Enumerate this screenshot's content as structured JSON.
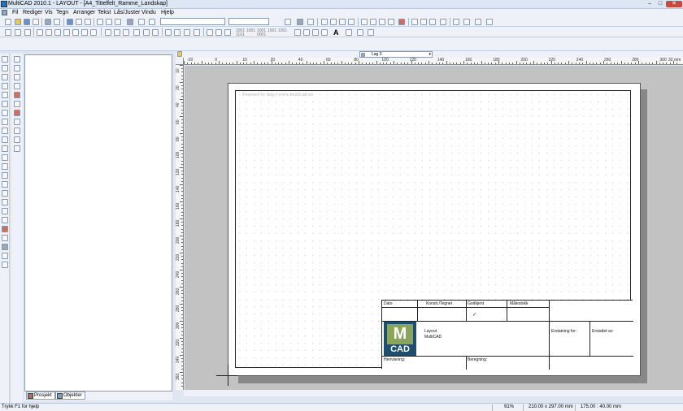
{
  "window": {
    "title": "MultiCAD 2010.1 - LAYOUT - [A4_Tittelfelt_Ramme_Landskap]",
    "minimize": "–",
    "maximize": "□",
    "close": "✕"
  },
  "menu": [
    "Fil",
    "Rediger",
    "Vis",
    "Tegn",
    "Arranger",
    "Tekst",
    "Lås/Juster",
    "Vindu",
    "Hjelp"
  ],
  "toolbar": {
    "text_glyph": "A",
    "snap_labels": [
      "1001",
      "1101",
      "1001",
      "1001",
      "1001",
      "0001",
      "1001"
    ]
  },
  "layer": {
    "label": "Lag 0"
  },
  "ruler": {
    "h": [
      "-20",
      "0",
      "10",
      "20",
      "40",
      "60",
      "80",
      "100",
      "120",
      "140",
      "160",
      "180",
      "200",
      "220",
      "240",
      "260",
      "280",
      "300",
      "32 mm"
    ],
    "v": [
      "10",
      "20",
      "40",
      "60",
      "80",
      "100",
      "120",
      "140",
      "160",
      "180",
      "200",
      "220",
      "240",
      "260",
      "280",
      "300",
      "320",
      "340",
      "360"
    ]
  },
  "drawing": {
    "watermark": "Powered by http://www.multicad.no",
    "titleblock": {
      "dato": "Dato",
      "konstr": "Konstr./Tegnet",
      "godkjent": "Godkjent",
      "malestokk": "Målestokk",
      "check": "✓",
      "layout_line1": "Layout",
      "layout_line2": "MultiCAD",
      "erstatning": "Erstatning for:",
      "erstattet": "Erstattet av:",
      "henvisning": "Henvisning:",
      "beregning": "Beregning:",
      "logo_m": "M",
      "logo_cad": "CAD"
    }
  },
  "panel_tabs": [
    "Prosjekt",
    "Objekter"
  ],
  "status": {
    "help": "Trykk F1 for hjelp",
    "zoom": "91%",
    "size": "210.00 x 297.00 mm",
    "coords": "175.00 : 40.00 mm"
  },
  "colors": {
    "logo_green": "#8aa45a",
    "logo_blue": "#1d4d6f",
    "close_button": "#c94a3b"
  }
}
